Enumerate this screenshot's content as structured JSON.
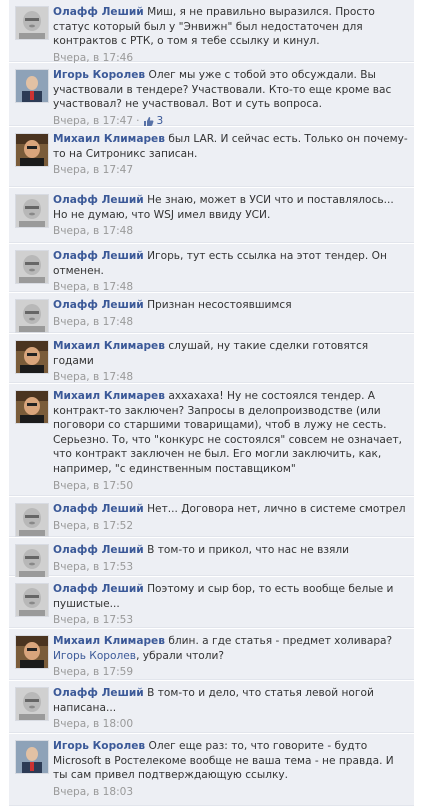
{
  "authors": {
    "olaf": "Олафф Леший",
    "igor": "Игорь Королев",
    "mikhail": "Михаил Климарев"
  },
  "comments": [
    {
      "author": "Олафф Леший",
      "text": "Миш, я не правильно выразился. Просто статус который был у \"Энвижн\" был недостаточен для контрактов с РТК, о том я тебе ссылку и кинул.",
      "time": "Вчера, в 17:46"
    },
    {
      "author": "Игорь Королев",
      "text": "Олег мы уже с тобой это обсуждали. Вы участвовали в тендере? Участвовали. Кто-то еще кроме вас участвовал? не участвовал. Вот и суть вопроса.",
      "time": "Вчера, в 17:47",
      "sep": "·",
      "likes": "3"
    },
    {
      "author": "Михаил Климарев",
      "text": "был LAR. И сейчас есть. Только он почему-то на Ситроникс записан.",
      "time": "Вчера, в 17:47"
    },
    {
      "author": "Олафф Леший",
      "text": "Не знаю, может в УСИ что и поставлялось... Но не думаю, что WSJ имел ввиду УСИ.",
      "time": "Вчера, в 17:48"
    },
    {
      "author": "Олафф Леший",
      "text": "Игорь, тут есть ссылка на этот тендер. Он отменен.",
      "time": "Вчера, в 17:48"
    },
    {
      "author": "Олафф Леший",
      "text": "Признан несостоявшимся",
      "time": "Вчера, в 17:48"
    },
    {
      "author": "Михаил Климарев",
      "text": "слушай, ну такие сделки готовятся годами",
      "time": "Вчера, в 17:48"
    },
    {
      "author": "Михаил Климарев",
      "text": "аххахаха! Ну не состоялся тендер. А контракт-то заключен? Запросы в делопроизводстве (или поговори со старшими товарищами), чтоб в лужу не сесть. Серьезно. То, что \"конкурс не состоялся\" совсем не означает, что контракт заключен не был. Его могли заключить, как, например, \"с единственным поставщиком\"",
      "time": "Вчера, в 17:50"
    },
    {
      "author": "Олафф Леший",
      "text": "Нет... Договора нет, лично в системе смотрел",
      "time": "Вчера, в 17:52"
    },
    {
      "author": "Олафф Леший",
      "text": "В том-то и прикол, что нас не взяли",
      "time": "Вчера, в 17:53"
    },
    {
      "author": "Олафф Леший",
      "text": "Поэтому и сыр бор, то есть вообще белые и пушистые...",
      "time": "Вчера, в 17:53"
    },
    {
      "author": "Михаил Климарев",
      "text": "блин. а где статья - предмет холивара?",
      "mention": "Игорь Королев",
      "text_after": ", убрали чтоли?",
      "time": "Вчера, в 17:59"
    },
    {
      "author": "Олафф Леший",
      "text": "В том-то и дело, что статья левой ногой написана...",
      "time": "Вчера, в 18:00"
    },
    {
      "author": "Игорь Королев",
      "text": "Олег еще раз: то, что говорите - будто Microsoft в Ростелекоме вообще не ваша тема - не правда. И ты сам привел подтверждающую ссылку.",
      "time": "Вчера, в 18:03"
    }
  ],
  "colors": {
    "link": "#3b5998",
    "bubble": "#edeff4",
    "meta": "#999999"
  },
  "icons": {
    "like": "thumbs-up-icon",
    "avatar": "profile-photo-icon"
  }
}
